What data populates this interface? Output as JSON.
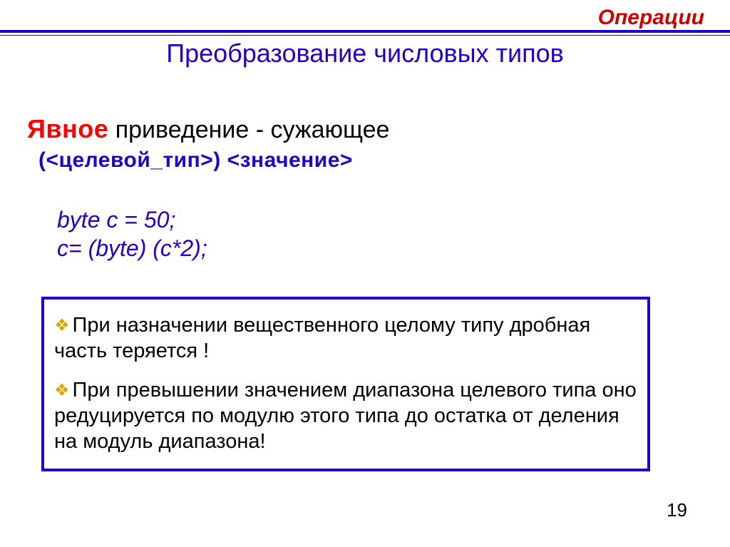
{
  "header": {
    "section": "Операции",
    "title": "Преобразование числовых типов"
  },
  "explicit": {
    "keyword": "Явное",
    "rest": "  приведение  - сужающее",
    "syntax": "(<целевой_тип>) <значение>"
  },
  "code": {
    "l1": "byte c = 50;",
    "l2": "c= (byte) (c*2);"
  },
  "notes": {
    "n1": "При назначении вещественного целому типу дробная часть теряется !",
    "n2": "При превышении значением диапазона целевого типа оно редуцируется по модулю этого типа до остатка от деления на модуль диапазона!"
  },
  "page": "19"
}
